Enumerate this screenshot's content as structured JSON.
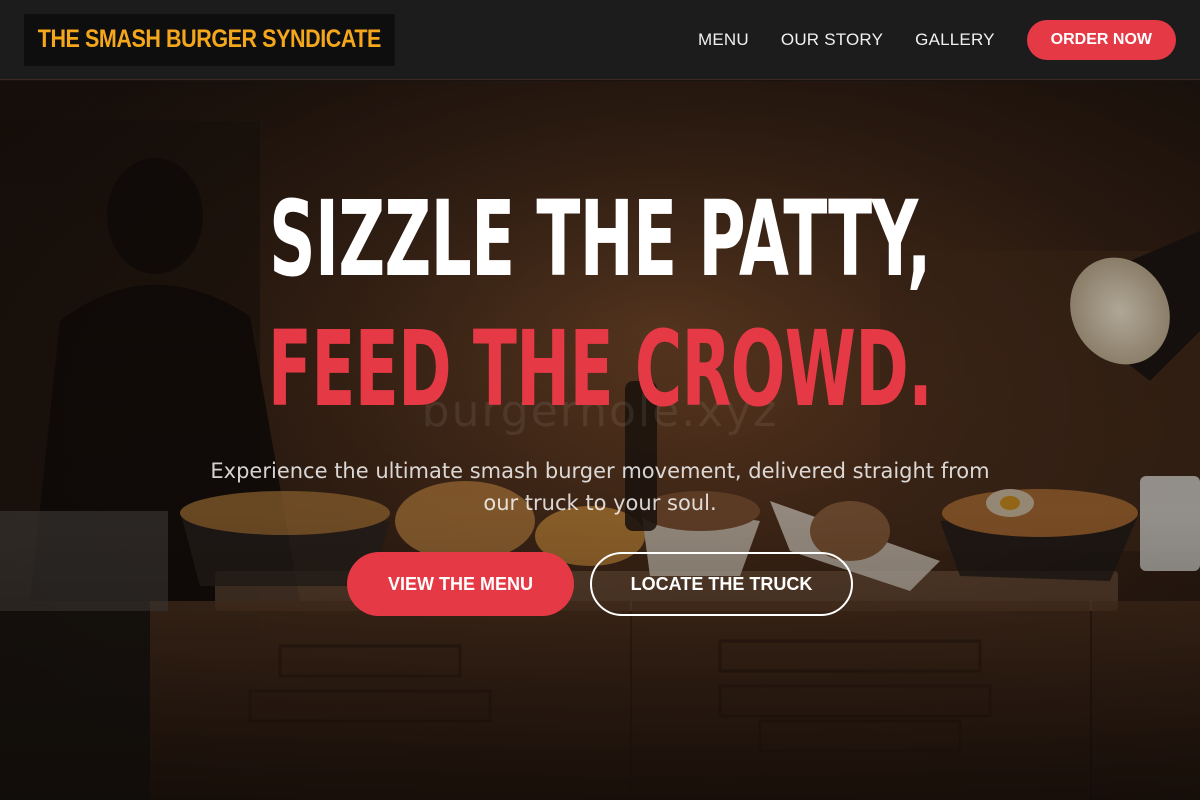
{
  "brand": {
    "name": "THE SMASH BURGER SYNDICATE"
  },
  "nav": {
    "links": [
      "MENU",
      "OUR STORY",
      "GALLERY"
    ],
    "order_label": "ORDER NOW"
  },
  "hero": {
    "headline_line1": "SIZZLE THE PATTY,",
    "headline_line2": "FEED THE CROWD.",
    "watermark": "burgerhole.xyz",
    "subtitle": "Experience the ultimate smash burger movement, delivered straight from our truck to your soul.",
    "primary_cta": "VIEW THE MENU",
    "secondary_cta": "LOCATE THE TRUCK"
  },
  "colors": {
    "accent": "#e63946",
    "logo": "#f5a71b",
    "header_bg": "#1c1c1c"
  }
}
